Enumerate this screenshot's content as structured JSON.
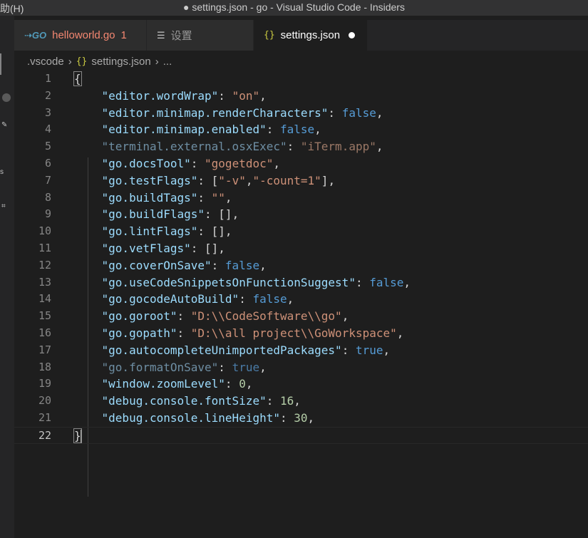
{
  "titlebar": {
    "menu_fragment": "助(H)",
    "title": "● settings.json - go - Visual Studio Code - Insiders"
  },
  "activitybar": {
    "fragments": [
      "s"
    ]
  },
  "tabs": [
    {
      "label": "helloworld.go",
      "icon": "go-file-icon",
      "problems": "1",
      "active": false
    },
    {
      "label": "设置",
      "icon": "settings-list-icon",
      "active": false
    },
    {
      "label": "settings.json",
      "icon": "json-braces-icon",
      "active": true,
      "modified": true
    }
  ],
  "breadcrumb": {
    "folder": ".vscode",
    "file": "settings.json",
    "more": "..."
  },
  "editor": {
    "line_numbers": [
      "1",
      "2",
      "3",
      "4",
      "5",
      "6",
      "7",
      "8",
      "9",
      "10",
      "11",
      "12",
      "13",
      "14",
      "15",
      "16",
      "17",
      "18",
      "19",
      "20",
      "21",
      "22"
    ],
    "current_line": "22",
    "settings": [
      {
        "key": "\"editor.wordWrap\"",
        "value": "\"on\""
      },
      {
        "key": "\"editor.minimap.renderCharacters\"",
        "value": "false"
      },
      {
        "key": "\"editor.minimap.enabled\"",
        "value": "false"
      },
      {
        "key": "\"terminal.external.osxExec\"",
        "value": "\"iTerm.app\""
      },
      {
        "key": "\"go.docsTool\"",
        "value": "\"gogetdoc\""
      },
      {
        "key": "\"go.testFlags\"",
        "value_parts": [
          "[",
          "\"-v\"",
          ",",
          "\"-count=1\"",
          "]"
        ]
      },
      {
        "key": "\"go.buildTags\"",
        "value": "\"\""
      },
      {
        "key": "\"go.buildFlags\"",
        "value": "[]"
      },
      {
        "key": "\"go.lintFlags\"",
        "value": "[]"
      },
      {
        "key": "\"go.vetFlags\"",
        "value": "[]"
      },
      {
        "key": "\"go.coverOnSave\"",
        "value": "false"
      },
      {
        "key": "\"go.useCodeSnippetsOnFunctionSuggest\"",
        "value": "false"
      },
      {
        "key": "\"go.gocodeAutoBuild\"",
        "value": "false"
      },
      {
        "key": "\"go.goroot\"",
        "value": "\"D:\\\\CodeSoftware\\\\go\""
      },
      {
        "key": "\"go.gopath\"",
        "value": "\"D:\\\\all project\\\\GoWorkspace\""
      },
      {
        "key": "\"go.autocompleteUnimportedPackages\"",
        "value": "true"
      },
      {
        "key": "\"go.formatOnSave\"",
        "value": "true"
      },
      {
        "key": "\"window.zoomLevel\"",
        "value": "0"
      },
      {
        "key": "\"debug.console.fontSize\"",
        "value": "16"
      },
      {
        "key": "\"debug.console.lineHeight\"",
        "value": "30"
      }
    ],
    "open_brace": "{",
    "close_brace": "}",
    "colon": ": ",
    "comma": ","
  },
  "colors": {
    "key": "#9cdcfe",
    "string": "#ce9178",
    "boolean": "#569cd6",
    "number": "#b5cea8",
    "background": "#1e1e1e"
  }
}
